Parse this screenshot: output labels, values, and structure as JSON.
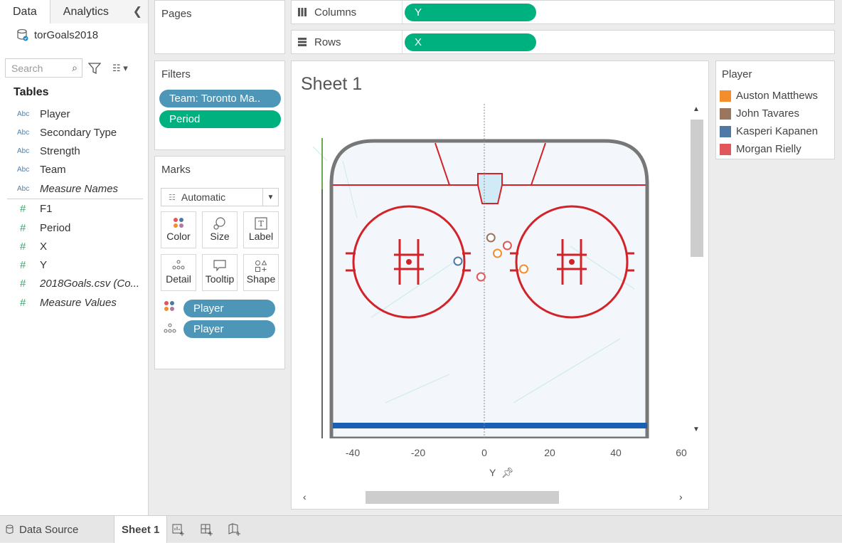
{
  "data_pane": {
    "tabs": [
      "Data",
      "Analytics"
    ],
    "datasource": "torGoals2018",
    "search_placeholder": "Search",
    "tables_title": "Tables",
    "dimensions": [
      {
        "type": "Abc",
        "label": "Player"
      },
      {
        "type": "Abc",
        "label": "Secondary Type"
      },
      {
        "type": "Abc",
        "label": "Strength"
      },
      {
        "type": "Abc",
        "label": "Team"
      },
      {
        "type": "Abc",
        "label": "Measure Names"
      }
    ],
    "measures": [
      {
        "type": "#",
        "label": "F1"
      },
      {
        "type": "#",
        "label": "Period"
      },
      {
        "type": "#",
        "label": "X"
      },
      {
        "type": "#",
        "label": "Y"
      },
      {
        "type": "#",
        "label": "2018Goals.csv (Co..."
      },
      {
        "type": "#",
        "label": "Measure Values"
      }
    ]
  },
  "pages": {
    "title": "Pages"
  },
  "filters": {
    "title": "Filters",
    "pills": [
      "Team: Toronto Ma..",
      "Period"
    ]
  },
  "marks": {
    "title": "Marks",
    "type": "Automatic",
    "buttons": [
      "Color",
      "Size",
      "Label",
      "Detail",
      "Tooltip",
      "Shape"
    ],
    "shelf_pills": [
      "Player",
      "Player"
    ]
  },
  "shelves": {
    "columns_label": "Columns",
    "columns_pill": "Y",
    "rows_label": "Rows",
    "rows_pill": "X"
  },
  "sheet": {
    "title": "Sheet 1"
  },
  "chart_data": {
    "type": "scatter",
    "title": "Sheet 1",
    "xlabel": "Y",
    "x_ticks": [
      "-40",
      "-20",
      "0",
      "20",
      "40",
      "60"
    ],
    "xlim": [
      -54,
      60
    ],
    "legend_title": "Player",
    "legend_placement": "right",
    "series": [
      {
        "name": "Auston Matthews",
        "color": "#f28e2b",
        "points": [
          [
            4,
            0
          ],
          [
            12,
            -2
          ]
        ]
      },
      {
        "name": "John Tavares",
        "color": "#9c755f",
        "points": [
          [
            2,
            2
          ]
        ]
      },
      {
        "name": "Kasperi Kapanen",
        "color": "#4e79a7",
        "points": [
          [
            -8,
            -1
          ]
        ]
      },
      {
        "name": "Morgan Rielly",
        "color": "#e15759",
        "points": [
          [
            7,
            1
          ],
          [
            -1,
            -3
          ]
        ]
      }
    ]
  },
  "legend": {
    "title": "Player",
    "items": [
      {
        "label": "Auston Matthews",
        "color": "#f28e2b"
      },
      {
        "label": "John Tavares",
        "color": "#9c755f"
      },
      {
        "label": "Kasperi Kapanen",
        "color": "#4e79a7"
      },
      {
        "label": "Morgan Rielly",
        "color": "#e15759"
      }
    ]
  },
  "bottom_tabs": {
    "datasource": "Data Source",
    "sheet": "Sheet 1"
  }
}
